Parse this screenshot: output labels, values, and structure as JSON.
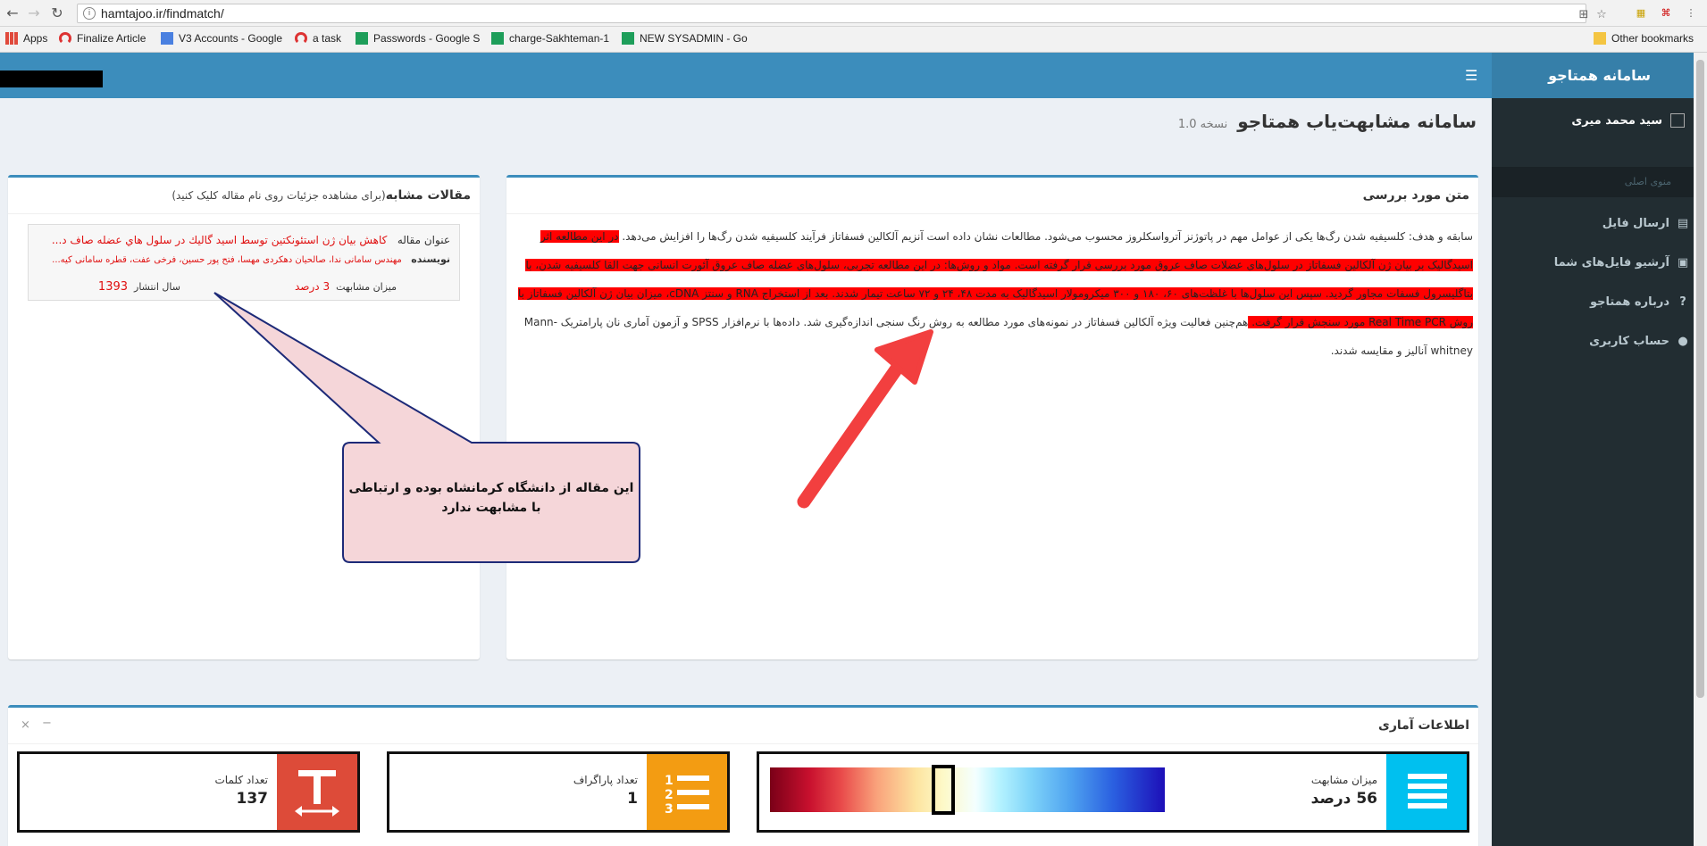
{
  "browser": {
    "url": "hamtajoo.ir/findmatch/",
    "bookmarks": [
      "Apps",
      "Finalize Article",
      "V3 Accounts - Google",
      "a task",
      "Passwords - Google S",
      "charge-Sakhteman-1",
      "NEW SYSADMIN - Go"
    ],
    "other_bookmarks": "Other bookmarks"
  },
  "sidebar": {
    "logo": "سامانه همتاجو",
    "user_name": "سید محمد میری",
    "menu_header": "منوی اصلی",
    "items": [
      {
        "label": "ارسال فایل",
        "icon": "file-icon"
      },
      {
        "label": "آرشیو فایل‌های شما",
        "icon": "archive-icon"
      },
      {
        "label": "درباره همتاجو",
        "icon": "question-icon"
      },
      {
        "label": "حساب کاربری",
        "icon": "user-icon"
      }
    ]
  },
  "page": {
    "title": "سامانه مشابهت‌یاب همتاجو",
    "version": "نسخه 1.0"
  },
  "review": {
    "title": "متن مورد بررسی",
    "segments": [
      {
        "text": "سابقه و هدف: کلسیفیه شدن رگ‌ها یکی از عوامل مهم در پاتوژنز آترواسکلروز محسوب می‌شود. مطالعات نشان داده است آنزیم آلکالین فسفاتاز فرآیند کلسیفیه شدن رگ‌ها را افزایش می‌دهد. ",
        "hl": false
      },
      {
        "text": "در این مطالعه اثر اسیدگالیک بر بیان ژن آلکالین فسفاتاز در سلول‌های عضلات صاف عروق مورد بررسی قرار گرفته است. مواد و روش‌ها: در این مطالعه تجربی، سلول‌های عضله صاف عروق آئورت انسانی جهت القا کلسیفیه شدن، با بتاگلیسرول فسفات مجاور گردید. سپس این سلول‌ها با غلظت‌های ۶۰، ۱۸۰ و ۳۰۰ میکرومولار اسیدگالیک به مدت ۴۸، ۲۴ و ۷۲ ساعت تیمار شدند. بعد از استخراج RNA و سنتز cDNA، میزان بیان ژن آلکالین فسفاتاز با روش Real Time PCR مورد سنجش قرار گرفت. ",
        "hl": true
      },
      {
        "text": "هم‌چنین فعالیت ویژه آلکالین فسفاتاز در نمونه‌های مورد مطالعه به روش رنگ سنجی اندازه‌گیری شد. داده‌ها با نرم‌افزار SPSS و آزمون آماری نان پارامتریک Mann-whitney آنالیز و مقایسه شدند.",
        "hl": false
      }
    ]
  },
  "similar": {
    "title": "مقالات مشابه",
    "subtitle": "(برای مشاهده جزئیات روی نام مقاله کلیک کنید)",
    "article_label": "عنوان مقاله",
    "article_title": "كاهش بيان ژن استئونكتين توسط اسيد گاليك در سلول هاي عضله صاف د...",
    "author_label": "نویسنده",
    "authors": "مهندس سامانی ندا، صالحیان دهکردی مهسا، فتح پور حسین، فرخی عفت، قطره سامانی کیه...",
    "similarity_label": "میزان مشابهت",
    "similarity_value": "3 درصد",
    "year_label": "سال انتشار",
    "year_value": "1393"
  },
  "callout": {
    "text": "این مقاله از دانشگاه کرمانشاه بوده و ارتباطی با مشابهت ندارد"
  },
  "stats": {
    "title": "اطلاعات آماری",
    "similarity": {
      "label": "میزان مشابهت",
      "value": "56 درصد",
      "percent": 56
    },
    "paragraphs": {
      "label": "تعداد پاراگراف",
      "value": "1"
    },
    "words": {
      "label": "تعداد کلمات",
      "value": "137"
    }
  },
  "colors": {
    "header": "#3c8dbc",
    "sidebar": "#222d32",
    "highlight": "#ff0000",
    "stat_similarity": "#00c0ef",
    "stat_paragraphs": "#f39c12",
    "stat_words": "#dd4b39"
  }
}
